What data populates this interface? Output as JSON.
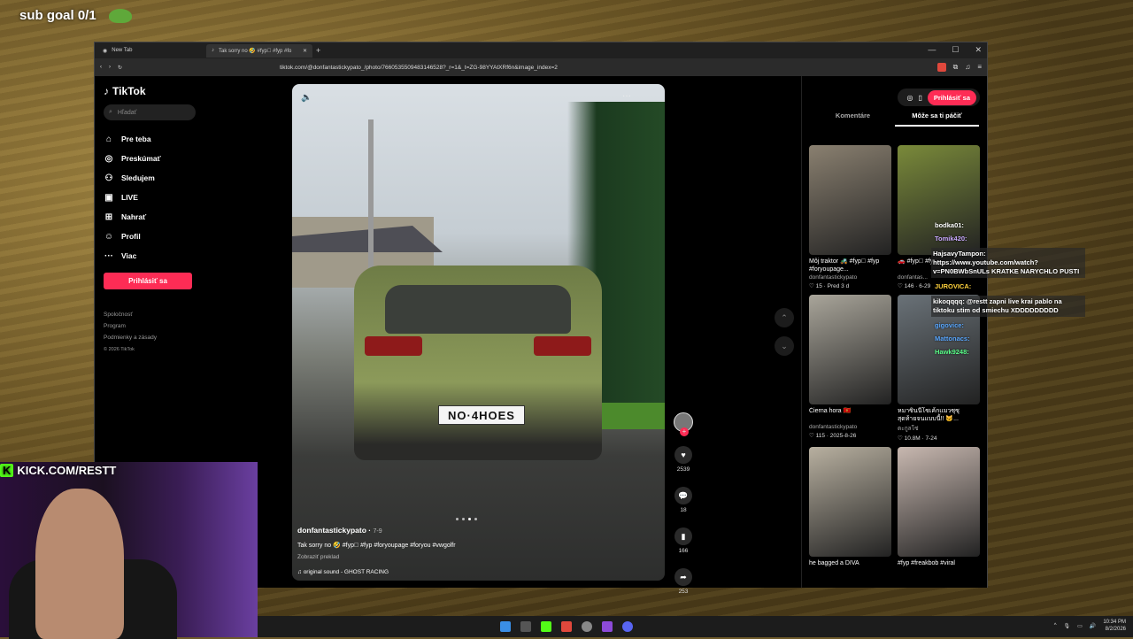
{
  "overlay": {
    "sub_goal": "sub goal 0/1",
    "kick": "KICK.COM/RESTT"
  },
  "browser": {
    "tabs": [
      {
        "label": "New Tab"
      },
      {
        "label": "Tak sorry no 🤣 #fyp゚ #fyp #fo"
      }
    ],
    "url": "tiktok.com/@donfantastickypato_/photo/7660535509483146528?_r=1&_t=ZG-98YYAtXRf6n&image_index=2"
  },
  "tiktok": {
    "logo": "TikTok",
    "search_placeholder": "Hľadať",
    "nav": [
      {
        "label": "Pre teba",
        "icon": "home-icon"
      },
      {
        "label": "Preskúmať",
        "icon": "compass-icon"
      },
      {
        "label": "Sledujem",
        "icon": "following-icon"
      },
      {
        "label": "LIVE",
        "icon": "live-icon"
      },
      {
        "label": "Nahrať",
        "icon": "upload-icon"
      },
      {
        "label": "Profil",
        "icon": "profile-icon"
      },
      {
        "label": "Viac",
        "icon": "more-icon"
      }
    ],
    "login": "Prihlásiť sa",
    "footer": [
      "Spoločnosť",
      "Program",
      "Podmienky a zásady",
      "© 2026 TikTok"
    ],
    "post": {
      "author": "donfantastickypato",
      "date": "7-9",
      "caption": "Tak sorry no 🤣 #fyp゚ #fyp #foryoupage #foryou #vwgolfr",
      "translate": "Zobraziť preklad",
      "sound": "original sound - GHOST RACING",
      "plate": "NO·4HOES"
    },
    "actions": {
      "likes": "2539",
      "comments": "18",
      "saves": "166",
      "shares": "253"
    },
    "right": {
      "login": "Prihlásiť sa",
      "tabs": [
        "Komentáre",
        "Môže sa ti páčiť"
      ],
      "cards": [
        {
          "title": "Môj traktor 🚜 #fyp゚ #fyp #foryoupage...",
          "author": "donfantastickypato",
          "stats": "♡ 15 · Pred 3 d",
          "color": "#8a8070"
        },
        {
          "title": "🚗 #fyp゚ #fy...",
          "author": "donfantas...",
          "stats": "♡ 146 · 6-29",
          "color": "#7a8a3a"
        },
        {
          "title": "Čierna hora 🇲🇪",
          "author": "donfantastickypato",
          "stats": "♡ 115 · 2025-8-26",
          "color": "#a9a59a"
        },
        {
          "title": "หมาซินนี่โซเค้กแมวซุซุ สุดท้ายจนแบบนี้!! 🐱...",
          "author": "ตะกูลโซ่",
          "stats": "♡ 10.8M · 7-24",
          "color": "#6a7278"
        },
        {
          "title": "he bagged a DIVA",
          "author": "",
          "stats": "",
          "color": "#b8b0a0"
        },
        {
          "title": "#fyp #freakbob #viral",
          "author": "",
          "stats": "",
          "color": "#c8b8b0"
        }
      ]
    }
  },
  "chat": [
    {
      "text": "bodka01:"
    },
    {
      "text": "Tomik420:"
    },
    {
      "text": "HajsavyTampon: https://www.youtube.com/watch?v=PN0BWbSnULs KRATKE NARYCHLO PUSTI"
    },
    {
      "text": "JUROVICA:"
    },
    {
      "text": "kikoqqqq: @restt zapni live krai pablo na tiktoku stim od smiechu XDDDDDDDDD"
    },
    {
      "text": "gigovice:"
    },
    {
      "text": "Mattonacs:"
    },
    {
      "text": "Hawk9248:"
    }
  ],
  "taskbar": {
    "time": "10:34 PM",
    "date": "8/2/2026"
  }
}
